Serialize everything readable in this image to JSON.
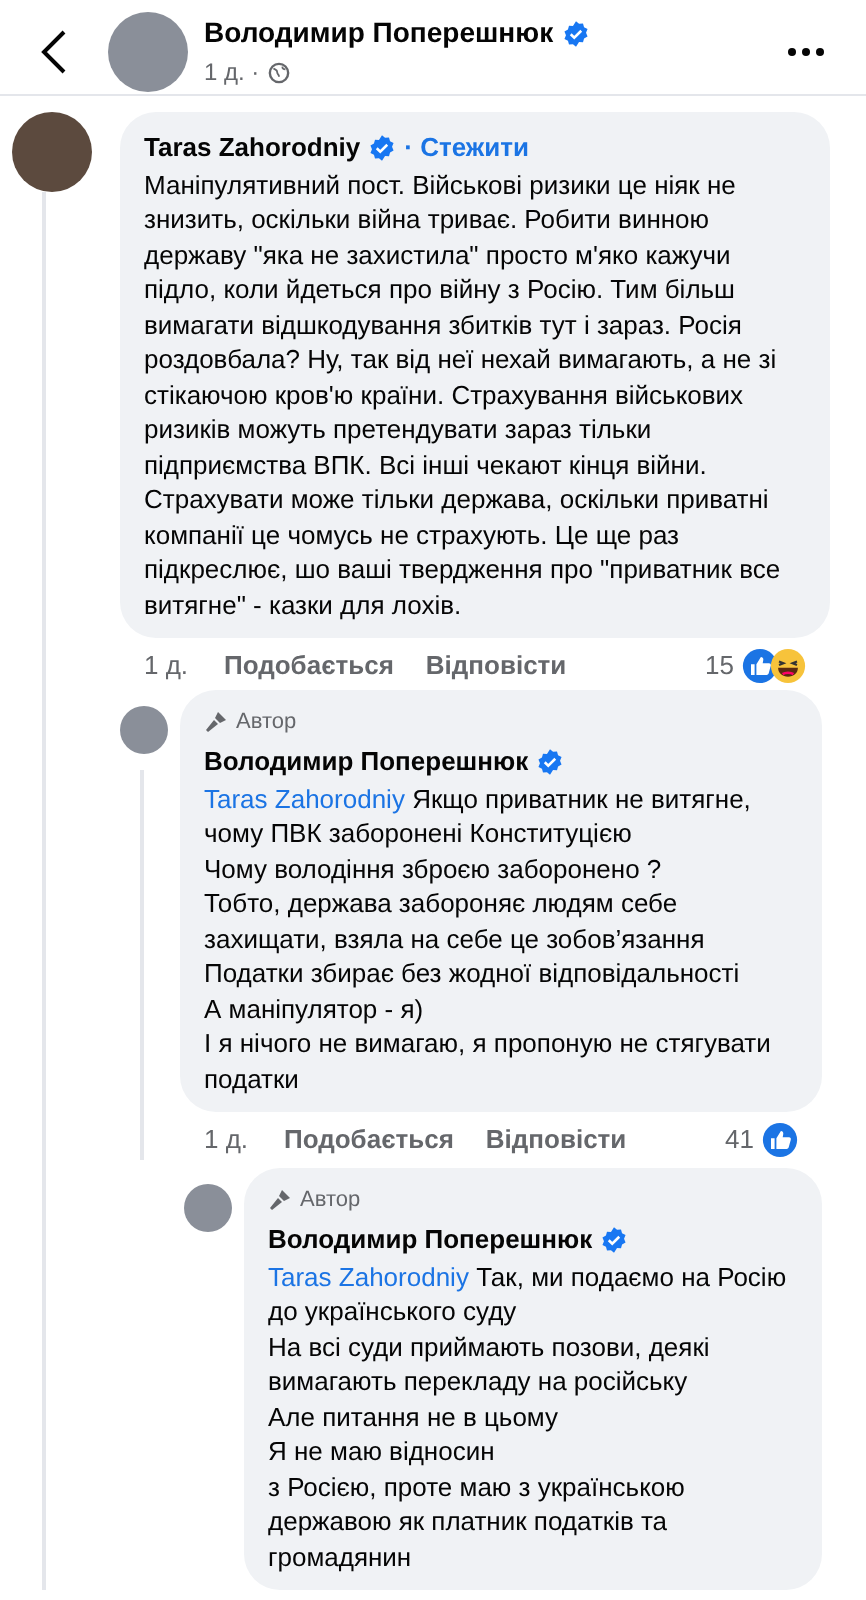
{
  "header": {
    "name": "Володимир Поперешнюк",
    "time": "1 д. ·",
    "verified": true
  },
  "comment": {
    "name": "Taras Zahorodniy",
    "verified": true,
    "follow": "· Стежити",
    "text": "Маніпулятивний пост. Військові ризики це ніяк не знизить, оскільки війна триває. Робити винною державу \"яка не захистила\" просто м'яко кажучи підло, коли йдеться про війну з Росію. Тим більш вимагати відшкодування збитків тут і зараз. Росія роздовбала? Ну, так від неї нехай вимагають, а не зі стікаючою кров'ю країни. Страхування військових ризиків можуть претендувати зараз тільки підприємства ВПК. Всі інші чекают кінця війни. Страхувати може тільки держава, оскільки приватні компанії це чомусь не страхують. Це ще раз підкреслює, шо ваші твердження про \"приватник все витягне\" - казки для лохів.",
    "time": "1 д.",
    "like": "Подобається",
    "reply": "Відповісти",
    "count": "15",
    "like_reaction": true,
    "haha_reaction": true
  },
  "replies": [
    {
      "badge": "Автор",
      "name": "Володимир Поперешнюк",
      "verified": true,
      "mention": "Taras Zahorodniy",
      "text": " Якщо приватник не витягне,\nчому ПВК заборонені Конституцією\nЧому володіння зброєю заборонено ?\nТобто, держава забороняє людям себе\nзахищати, взяла на себе це зобов’язання\nПодатки збирає без жодної відповідальності\nА маніпулятор - я)\nІ я нічого не вимагаю, я пропоную не стягувати\nподатки",
      "time": "1 д.",
      "like": "Подобається",
      "reply": "Відповісти",
      "count": "41",
      "like_reaction": true
    },
    {
      "badge": "Автор",
      "name": "Володимир Поперешнюк",
      "verified": true,
      "mention": "Taras Zahorodniy",
      "text": " Так, ми подаємо на Росію\nдо українського суду\nНа всі суди приймають позови, деякі\nвимагають перекладу на російську\nАле питання не в цьому\nЯ не маю відносин\nз Росією, проте маю з українською\nдержавою як платник податків та\nгромадянин"
    }
  ]
}
